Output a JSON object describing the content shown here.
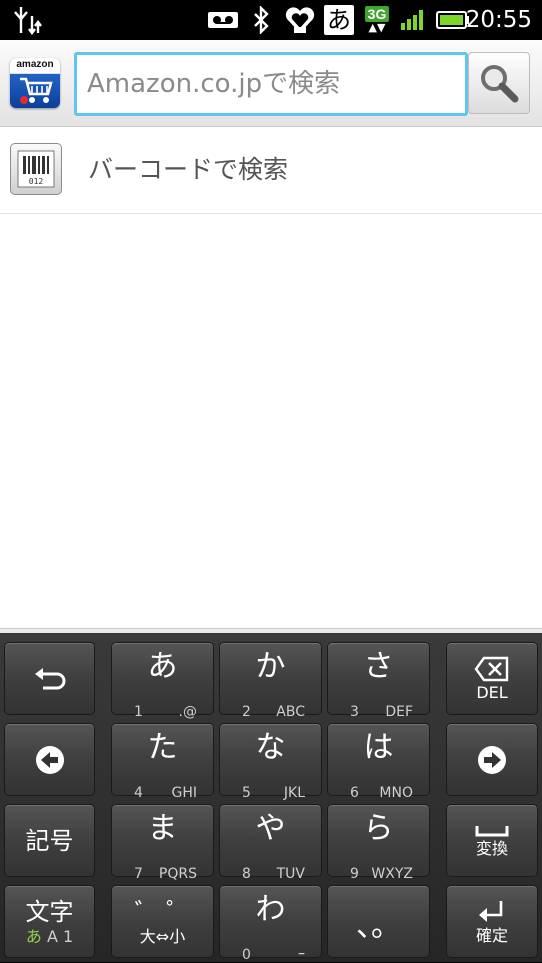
{
  "statusbar": {
    "time": "20:55",
    "network_type": "3G",
    "ime_indicator": "あ",
    "icons": [
      "usb-debug-icon",
      "voicemail-icon",
      "bluetooth-icon",
      "heart-icon",
      "ime-icon",
      "3g-icon",
      "signal-icon",
      "battery-icon"
    ]
  },
  "app": {
    "search": {
      "placeholder": "Amazon.co.jpで検索",
      "value": ""
    },
    "amazon_logo_text": "amazon",
    "suggestions": [
      {
        "label": "バーコードで検索"
      }
    ]
  },
  "keyboard": {
    "rows": [
      [
        {
          "type": "fn",
          "name": "undo-key",
          "icon": "undo-arrow-icon"
        },
        {
          "main": "あ",
          "num": "1",
          "letters": ".@"
        },
        {
          "main": "か",
          "num": "2",
          "letters": "ABC"
        },
        {
          "main": "さ",
          "num": "3",
          "letters": "DEF"
        },
        {
          "type": "fn",
          "name": "delete-key",
          "icon": "backspace-icon",
          "label": "DEL"
        }
      ],
      [
        {
          "type": "fn",
          "name": "left-arrow-key",
          "icon": "left-arrow-icon"
        },
        {
          "main": "た",
          "num": "4",
          "letters": "GHI"
        },
        {
          "main": "な",
          "num": "5",
          "letters": "JKL"
        },
        {
          "main": "は",
          "num": "6",
          "letters": "MNO"
        },
        {
          "type": "fn",
          "name": "right-arrow-key",
          "icon": "right-arrow-icon"
        }
      ],
      [
        {
          "type": "fn",
          "name": "symbol-key",
          "label": "記号"
        },
        {
          "main": "ま",
          "num": "7",
          "letters": "PQRS"
        },
        {
          "main": "や",
          "num": "8",
          "letters": "TUV"
        },
        {
          "main": "ら",
          "num": "9",
          "letters": "WXYZ"
        },
        {
          "type": "fn",
          "name": "space-convert-key",
          "icon": "space-icon",
          "label": "変換"
        }
      ],
      [
        {
          "type": "fn",
          "name": "input-mode-key",
          "label": "文字",
          "sub_active": "あ",
          "sub_rest": "A 1"
        },
        {
          "type": "fn",
          "name": "dakuten-key",
          "label": "゛ ゜",
          "sub": "大⇔小"
        },
        {
          "main": "わ",
          "num": "0",
          "letters": "ｰ"
        },
        {
          "type": "fn",
          "name": "punctuation-key",
          "label": "、。"
        },
        {
          "type": "fn",
          "name": "enter-key",
          "icon": "enter-icon",
          "label": "確定"
        }
      ]
    ]
  },
  "colors": {
    "search_focus": "#5ec6ef",
    "ime_active": "#8fd14f",
    "battery": "#7fd62a"
  }
}
